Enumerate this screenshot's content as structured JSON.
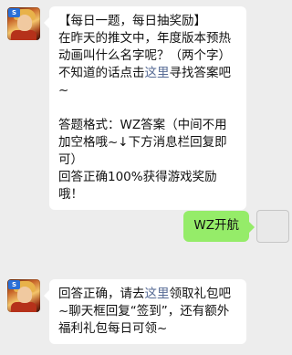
{
  "messages": [
    {
      "sender": "bot",
      "lines": {
        "l1": "【每日一题，每日抽奖励】",
        "l2": "在昨天的推文中，年度版本预热动画叫什么名字呢？（两个字）",
        "l3a": "不知道的话点击",
        "l3link": "这里",
        "l3b": "寻找答案吧~",
        "l4": "答题格式：WZ答案（中间不用加空格哦~↓下方消息栏回复即可）",
        "l5": "回答正确100%获得游戏奖励哦！"
      }
    },
    {
      "sender": "user",
      "text": "WZ开航"
    },
    {
      "sender": "bot",
      "lines": {
        "p1": "回答正确，请去",
        "link": "这里",
        "p2": "领取礼包吧~聊天框回复“签到”，还有额外福利礼包每日可领~"
      }
    }
  ],
  "colors": {
    "background": "#ededed",
    "bot_bubble": "#ffffff",
    "user_bubble": "#95ec69",
    "link": "#576b95"
  }
}
